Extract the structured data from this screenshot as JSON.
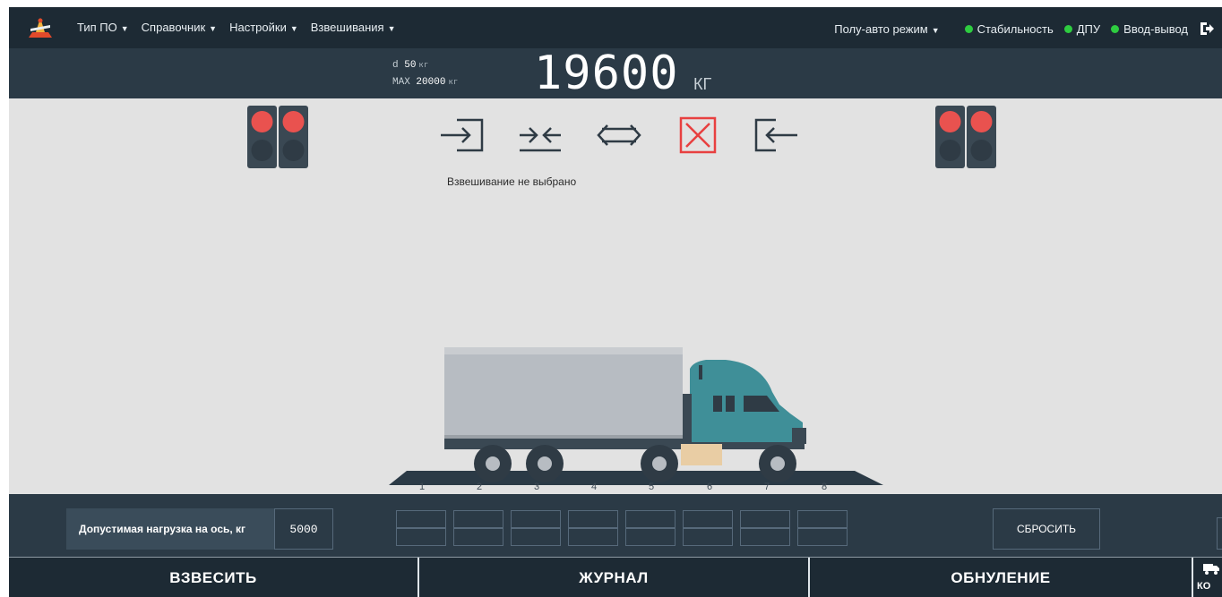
{
  "menu": {
    "items": [
      {
        "label": "Тип ПО"
      },
      {
        "label": "Справочник"
      },
      {
        "label": "Настройки"
      },
      {
        "label": "Взвешивания"
      }
    ],
    "mode": "Полу-авто режим",
    "indicators": [
      {
        "label": "Стабильность",
        "color": "#2ecc40"
      },
      {
        "label": "ДПУ",
        "color": "#2ecc40"
      },
      {
        "label": "Ввод-вывод",
        "color": "#2ecc40"
      }
    ],
    "exit_icon": "exit-icon"
  },
  "scale": {
    "d_label": "d",
    "d_value": "50",
    "d_unit": "кг",
    "max_label": "MAX",
    "max_value": "20000",
    "max_unit": "кг",
    "weight": "19600",
    "weight_unit": "КГ"
  },
  "traffic_lights": {
    "left": {
      "state": "red",
      "color": "#e9524f"
    },
    "right": {
      "state": "red",
      "color": "#e9524f"
    }
  },
  "operations": [
    {
      "icon": "entry-arrow-icon"
    },
    {
      "icon": "merge-arrows-icon"
    },
    {
      "icon": "bidirectional-arrows-icon"
    },
    {
      "icon": "cancel-x-icon",
      "color": "#e84040"
    },
    {
      "icon": "exit-arrow-icon"
    }
  ],
  "status_text": "Взвешивание не выбрано",
  "platform_positions": [
    "1",
    "2",
    "3",
    "4",
    "5",
    "6",
    "7",
    "8"
  ],
  "axle": {
    "label": "Допустимая нагрузка на ось, кг",
    "value": "5000"
  },
  "reset_label": "СБРОСИТЬ",
  "actions": {
    "weigh": "ВЗВЕСИТЬ",
    "journal": "ЖУРНАЛ",
    "zero": "ОБНУЛЕНИЕ",
    "corner_label": "КО"
  },
  "colors": {
    "header_bg": "#1d2a34",
    "panel_bg": "#2b3a46",
    "canvas_bg": "#e2e2e2",
    "truck_cab": "#3f8f98",
    "truck_box": "#b7bcc2"
  }
}
